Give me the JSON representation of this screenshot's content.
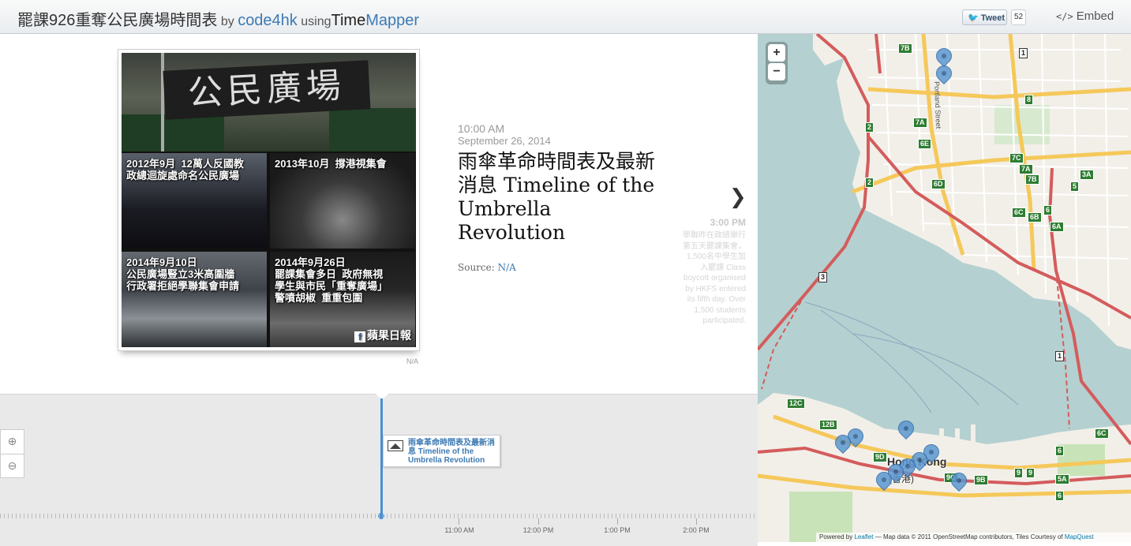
{
  "header": {
    "title": "罷課926重奪公民廣場時間表",
    "by": "by",
    "author": "code4hk",
    "using": "using",
    "tool_part1": "Time",
    "tool_part2": "Mapper",
    "tweet_label": "Tweet",
    "tweet_count": "52",
    "embed_icon": "</>",
    "embed_label": "Embed"
  },
  "slide": {
    "photo": {
      "banner_text": "公民廣場",
      "captions": [
        "2012年9月  12萬人反國教\n政總迴旋處命名公民廣場",
        "2013年10月  撐港視集會",
        "2014年9月10日\n公民廣場豎立3米高圍牆\n行政署拒絕學聯集會申請",
        "2014年9月26日\n罷課集會多日  政府無視\n學生與市民「重奪廣場」\n警噴胡椒  重重包圍"
      ],
      "watermark": "蘋果日報",
      "credit": "N/A"
    },
    "time": "10:00 AM",
    "date": "September 26, 2014",
    "title": "雨傘革命時間表及最新消息 Timeline of the Umbrella Revolution",
    "source_label": "Source:",
    "source_value": "N/A",
    "next_time": "3:00 PM",
    "next_text": "學聯昨在政總舉行第五天罷課集會，1,500名中學生加入罷課 Class boycott organised by HKFS entered its fifth day. Over 1,500 students participated."
  },
  "timeline": {
    "marker_title": "雨傘革命時間表及最新消息 Timeline of the Umbrella Revolution",
    "tick_labels": [
      "11:00 AM",
      "12:00 PM",
      "1:00 PM",
      "2:00 PM"
    ]
  },
  "map": {
    "city_label": "Hong Kong",
    "city_label_zh": "(香港)",
    "street_label": "Portland Street",
    "zoom_in": "+",
    "zoom_out": "−",
    "attribution_prefix": "Powered by",
    "attribution_leaflet": "Leaflet",
    "attribution_text": "— Map data © 2011 OpenStreetMap contributors, Tiles Courtesy of",
    "attribution_mapquest": "MapQuest",
    "route_shields": [
      "7B",
      "1",
      "2",
      "7A",
      "6E",
      "8",
      "7C",
      "7A",
      "7B",
      "6D",
      "3A",
      "2",
      "5",
      "6C",
      "6B",
      "6",
      "6A",
      "3",
      "1",
      "12C",
      "12B",
      "9D",
      "9C",
      "9B",
      "6C",
      "6",
      "9",
      "9",
      "5A",
      "6"
    ]
  },
  "colors": {
    "accent": "#3d7ab3",
    "timeline_marker": "#4b8fd2",
    "water": "#b5d0d0",
    "land": "#f2efe9"
  }
}
